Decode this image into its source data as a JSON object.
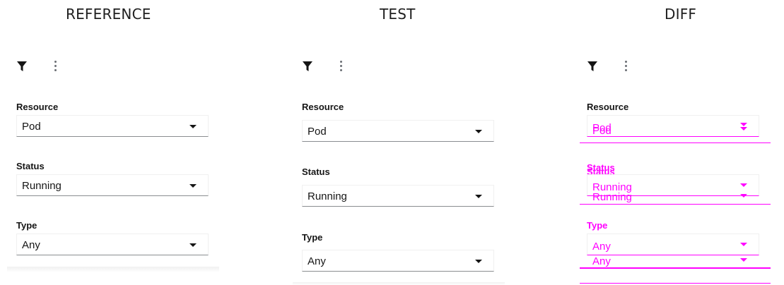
{
  "columns": {
    "reference": "REFERENCE",
    "test": "TEST",
    "diff": "DIFF"
  },
  "toolbar": {
    "filter_icon": "filter-icon",
    "kebab_icon": "kebab-icon"
  },
  "fields": {
    "resource": {
      "label": "Resource",
      "value": "Pod"
    },
    "status": {
      "label": "Status",
      "value": "Running"
    },
    "type": {
      "label": "Type",
      "value": "Any"
    }
  },
  "colors": {
    "diff_highlight": "#ff00ff",
    "select_underline": "#8a8d90",
    "text": "#151515"
  }
}
